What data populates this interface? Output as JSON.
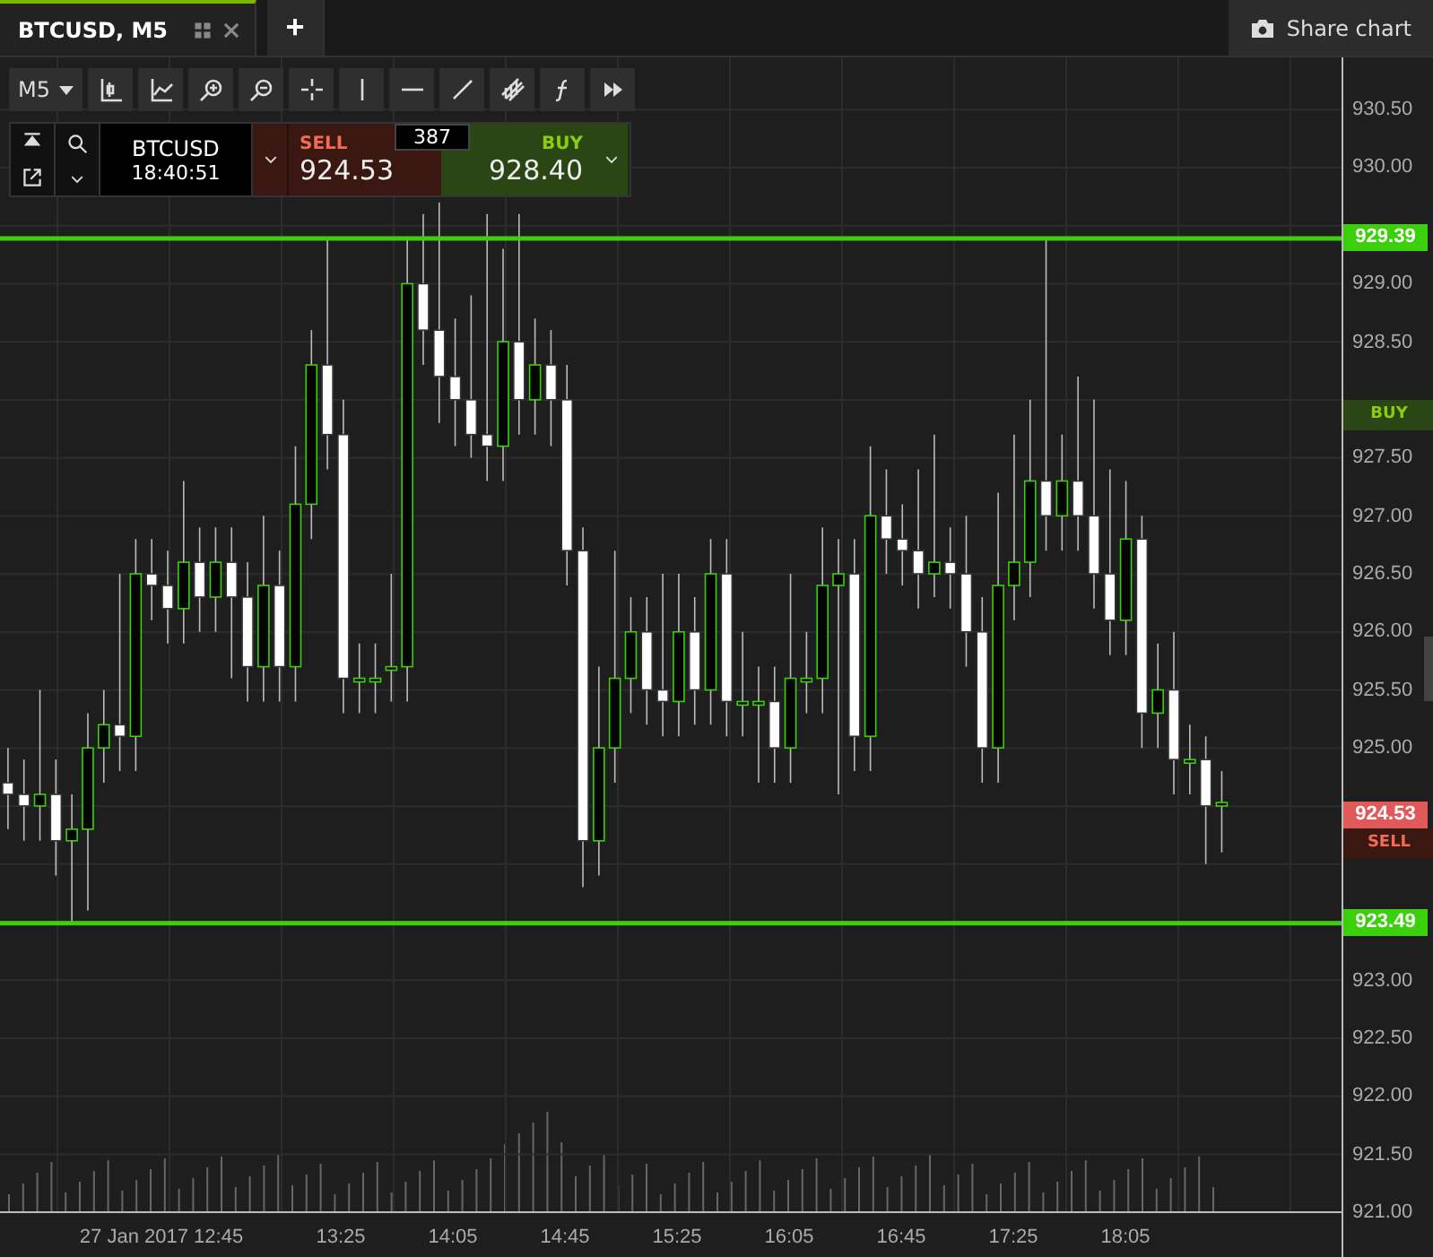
{
  "tabs": [
    {
      "label": "BTCUSD, M5",
      "selected": true
    }
  ],
  "new_tab_button": "+",
  "share_button": "Share chart",
  "toolbar": {
    "timeframe": "M5"
  },
  "trade_panel": {
    "symbol": "BTCUSD",
    "time": "18:40:51",
    "spread": "387",
    "sell": {
      "label": "SELL",
      "price": "924.53"
    },
    "buy": {
      "label": "BUY",
      "price": "928.40"
    }
  },
  "chart": {
    "time_labels": [
      "27 Jan 2017 12:45",
      "13:25",
      "14:05",
      "14:45",
      "15:25",
      "16:05",
      "16:45",
      "17:25",
      "18:05"
    ],
    "buy_marker": "BUY",
    "chart_data": {
      "type": "candlestick",
      "categories": [
        null,
        null,
        null,
        null,
        null,
        null,
        null,
        null,
        null,
        null,
        null,
        null,
        null,
        null,
        null,
        null,
        null,
        null,
        null,
        null,
        null,
        null,
        null,
        null,
        null,
        null,
        null,
        null,
        null,
        null,
        null,
        null,
        null,
        null,
        null,
        null,
        null,
        null,
        null,
        null,
        null,
        null,
        null,
        null,
        null,
        null,
        null,
        null,
        null,
        null,
        null,
        null,
        null,
        null,
        null,
        null,
        null,
        null,
        null,
        null,
        null,
        null,
        null,
        null,
        null,
        null,
        null,
        null,
        null,
        null,
        null,
        null,
        null,
        null,
        null,
        null,
        null,
        null,
        null,
        null,
        null,
        null,
        null,
        null
      ],
      "ylim": [
        921.0,
        930.95
      ],
      "grid": true,
      "ref_lines": [
        {
          "axis": "y",
          "value": 929.39,
          "label": "929.39",
          "color": "#3ccf0c"
        },
        {
          "axis": "y",
          "value": 923.49,
          "label": "923.49",
          "color": "#3ccf0c"
        }
      ],
      "yticks": [
        {
          "value": 930.5,
          "label": "930.50"
        },
        {
          "value": 930,
          "label": "930.00"
        },
        {
          "value": 929,
          "label": "929.00"
        },
        {
          "value": 928.5,
          "label": "928.50"
        },
        {
          "value": 927.5,
          "label": "927.50"
        },
        {
          "value": 927,
          "label": "927.00"
        },
        {
          "value": 926.5,
          "label": "926.50"
        },
        {
          "value": 926,
          "label": "926.00"
        },
        {
          "value": 925.5,
          "label": "925.50"
        },
        {
          "value": 925,
          "label": "925.00"
        },
        {
          "value": 923,
          "label": "923.00"
        },
        {
          "value": 922.5,
          "label": "922.50"
        },
        {
          "value": 922,
          "label": "922.00"
        },
        {
          "value": 921.5,
          "label": "921.50"
        },
        {
          "value": 921,
          "label": "921.00"
        }
      ],
      "ohlc": [
        [
          924.7,
          925.0,
          924.3,
          924.6
        ],
        [
          924.6,
          924.9,
          924.2,
          924.5
        ],
        [
          924.5,
          925.5,
          924.2,
          924.6
        ],
        [
          924.6,
          924.9,
          923.9,
          924.2
        ],
        [
          924.2,
          924.6,
          923.5,
          924.3
        ],
        [
          924.3,
          925.3,
          923.6,
          925.0
        ],
        [
          925.0,
          925.5,
          924.7,
          925.2
        ],
        [
          925.2,
          926.5,
          924.8,
          925.1
        ],
        [
          925.1,
          926.8,
          924.8,
          926.5
        ],
        [
          926.5,
          926.8,
          926.1,
          926.4
        ],
        [
          926.4,
          926.7,
          925.9,
          926.2
        ],
        [
          926.2,
          927.3,
          925.9,
          926.6
        ],
        [
          926.6,
          926.9,
          926.0,
          926.3
        ],
        [
          926.3,
          926.9,
          926.0,
          926.6
        ],
        [
          926.6,
          926.9,
          925.6,
          926.3
        ],
        [
          926.3,
          926.6,
          925.4,
          925.7
        ],
        [
          925.7,
          927.0,
          925.4,
          926.4
        ],
        [
          926.4,
          926.7,
          925.4,
          925.7
        ],
        [
          925.7,
          927.6,
          925.4,
          927.1
        ],
        [
          927.1,
          928.6,
          926.8,
          928.3
        ],
        [
          928.3,
          929.4,
          927.4,
          927.7
        ],
        [
          927.7,
          928.0,
          925.3,
          925.6
        ],
        [
          925.6,
          925.9,
          925.3,
          925.6
        ],
        [
          925.6,
          925.9,
          925.3,
          925.6
        ],
        [
          925.7,
          926.5,
          925.4,
          925.7
        ],
        [
          925.7,
          929.4,
          925.4,
          929.0
        ],
        [
          929.0,
          929.6,
          928.3,
          928.6
        ],
        [
          928.6,
          929.7,
          927.8,
          928.2
        ],
        [
          928.2,
          928.7,
          927.6,
          928.0
        ],
        [
          928.0,
          928.9,
          927.5,
          927.7
        ],
        [
          927.7,
          929.6,
          927.3,
          927.6
        ],
        [
          927.6,
          929.3,
          927.3,
          928.5
        ],
        [
          928.5,
          929.6,
          927.7,
          928.0
        ],
        [
          928.0,
          928.7,
          927.7,
          928.3
        ],
        [
          928.3,
          928.6,
          927.6,
          928.0
        ],
        [
          928.0,
          928.3,
          926.4,
          926.7
        ],
        [
          926.7,
          926.9,
          923.8,
          924.2
        ],
        [
          924.2,
          925.7,
          923.9,
          925.0
        ],
        [
          925.0,
          926.7,
          924.7,
          925.6
        ],
        [
          925.6,
          926.3,
          925.3,
          926.0
        ],
        [
          926.0,
          926.3,
          925.2,
          925.5
        ],
        [
          925.5,
          926.5,
          925.1,
          925.4
        ],
        [
          925.4,
          926.5,
          925.1,
          926.0
        ],
        [
          926.0,
          926.3,
          925.2,
          925.5
        ],
        [
          925.5,
          926.8,
          925.2,
          926.5
        ],
        [
          926.5,
          926.8,
          925.1,
          925.4
        ],
        [
          925.4,
          926.0,
          925.1,
          925.4
        ],
        [
          925.4,
          925.7,
          924.7,
          925.4
        ],
        [
          925.4,
          925.7,
          924.7,
          925.0
        ],
        [
          925.0,
          926.5,
          924.7,
          925.6
        ],
        [
          925.6,
          926.0,
          925.3,
          925.6
        ],
        [
          925.6,
          926.9,
          925.3,
          926.4
        ],
        [
          926.4,
          926.8,
          924.6,
          926.5
        ],
        [
          926.5,
          926.8,
          924.8,
          925.1
        ],
        [
          925.1,
          927.6,
          924.8,
          927.0
        ],
        [
          927.0,
          927.4,
          926.5,
          926.8
        ],
        [
          926.8,
          927.1,
          926.4,
          926.7
        ],
        [
          926.7,
          927.4,
          926.2,
          926.5
        ],
        [
          926.5,
          927.7,
          926.3,
          926.6
        ],
        [
          926.6,
          926.9,
          926.2,
          926.5
        ],
        [
          926.5,
          927.0,
          925.7,
          926.0
        ],
        [
          926.0,
          926.3,
          924.7,
          925.0
        ],
        [
          925.0,
          927.2,
          924.7,
          926.4
        ],
        [
          926.4,
          927.7,
          926.1,
          926.6
        ],
        [
          926.6,
          928.0,
          926.3,
          927.3
        ],
        [
          927.3,
          929.4,
          926.7,
          927.0
        ],
        [
          927.0,
          927.7,
          926.7,
          927.3
        ],
        [
          927.3,
          928.2,
          926.7,
          927.0
        ],
        [
          927.0,
          928.0,
          926.2,
          926.5
        ],
        [
          926.5,
          927.4,
          925.8,
          926.1
        ],
        [
          926.1,
          927.3,
          925.8,
          926.8
        ],
        [
          926.8,
          927.0,
          925.0,
          925.3
        ],
        [
          925.3,
          925.9,
          925.0,
          925.5
        ],
        [
          925.5,
          926.0,
          924.6,
          924.9
        ],
        [
          924.9,
          925.2,
          924.6,
          924.9
        ],
        [
          924.9,
          925.1,
          924.0,
          924.5
        ],
        [
          924.5,
          924.8,
          924.1,
          924.53
        ],
        null,
        null,
        null,
        null,
        null,
        null,
        null
      ]
    },
    "sell_marker": {
      "price": "924.53",
      "label": "SELL"
    }
  }
}
